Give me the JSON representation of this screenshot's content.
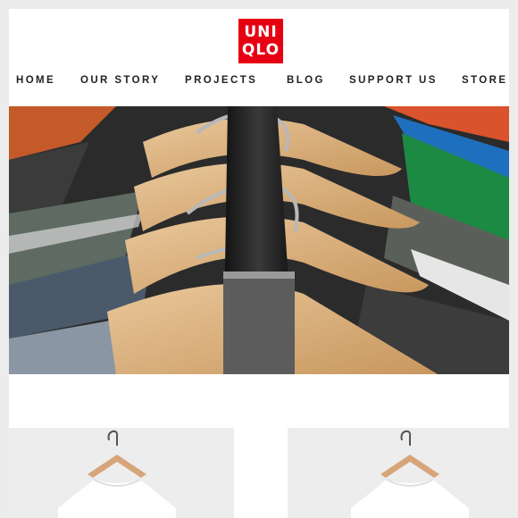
{
  "brand": {
    "logo_line1": "UNI",
    "logo_line2": "QLO",
    "color": "#e60012"
  },
  "nav": {
    "items": [
      {
        "label": "HOME"
      },
      {
        "label": "OUR STORY"
      },
      {
        "label": "PROJECTS"
      },
      {
        "label": "BLOG"
      },
      {
        "label": "SUPPORT US"
      },
      {
        "label": "STORE"
      }
    ]
  },
  "hero": {
    "image": "clothes-on-wooden-hangers-photo"
  },
  "products": [
    {
      "image": "white-tshirt-on-hanger"
    },
    {
      "image": "white-tshirt-on-hanger"
    }
  ]
}
